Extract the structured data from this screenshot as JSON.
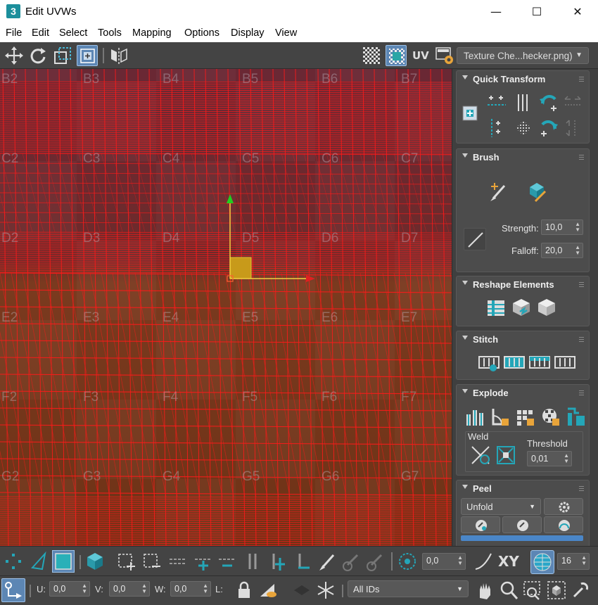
{
  "window": {
    "title": "Edit UVWs",
    "app_icon_text": "3",
    "minimize": "—",
    "maximize": "☐",
    "close": "✕"
  },
  "menu": [
    "File",
    "Edit",
    "Select",
    "Tools",
    "Mapping",
    "Options",
    "Display",
    "View"
  ],
  "toolbar": {
    "uv_label": "UV",
    "texture_select": "Texture Che...hecker.png)"
  },
  "grid_labels": {
    "columns": [
      "2",
      "3",
      "4",
      "5",
      "6",
      "7"
    ],
    "rows": [
      "B",
      "C",
      "D",
      "E",
      "F",
      "G"
    ]
  },
  "panel": {
    "quick_transform": {
      "title": "Quick Transform"
    },
    "brush": {
      "title": "Brush",
      "strength_label": "Strength:",
      "strength_value": "10,0",
      "falloff_label": "Falloff:",
      "falloff_value": "20,0"
    },
    "reshape": {
      "title": "Reshape Elements"
    },
    "stitch": {
      "title": "Stitch"
    },
    "explode": {
      "title": "Explode",
      "weld_label": "Weld",
      "threshold_label": "Threshold",
      "threshold_value": "0,01"
    },
    "peel": {
      "title": "Peel",
      "mode_value": "Unfold"
    }
  },
  "bottom": {
    "rotate_value": "0,0",
    "xy_label": "XY",
    "zoom_value": "16",
    "u_label": "U:",
    "u_value": "0,0",
    "v_label": "V:",
    "v_value": "0,0",
    "w_label": "W:",
    "w_value": "0,0",
    "l_label": "L:",
    "ids_value": "All IDs"
  },
  "colors": {
    "mesh": "#ff1a1a",
    "panel_bg": "#4c4c4c",
    "accent": "#24a6b8",
    "active": "#5c86b4"
  }
}
